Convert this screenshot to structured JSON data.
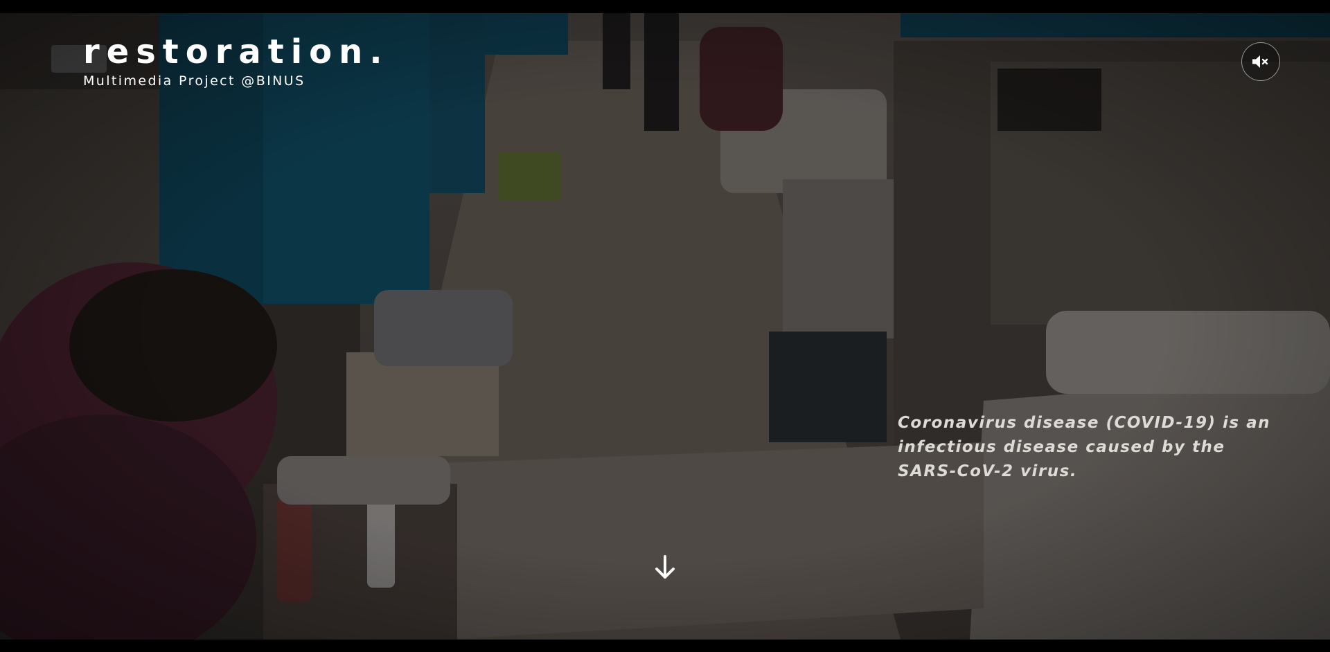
{
  "brand": {
    "title": "restoration.",
    "subtitle": "Multimedia Project @BINUS"
  },
  "hero": {
    "caption": "Coronavirus disease (COVID-19) is an infectious disease caused by the SARS-CoV-2 virus.",
    "background": "hospital ward video frame"
  },
  "controls": {
    "mute_icon": "volume-muted-icon",
    "scroll_icon": "arrow-down-icon"
  },
  "colors": {
    "text": "#ffffff",
    "caption": "#dedbd6",
    "letterbox": "#000000"
  }
}
